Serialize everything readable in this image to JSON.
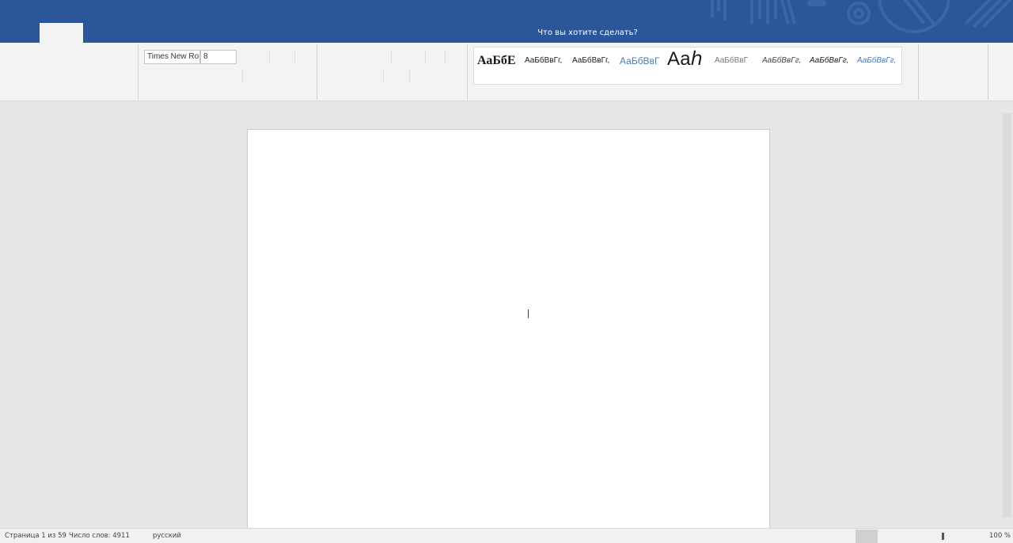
{
  "title_bar": {
    "tell_me": "Что вы хотите сделать?",
    "colors": {
      "background": "#2b579a",
      "active_tab": "#f3f3f3"
    }
  },
  "ribbon": {
    "font_name": "Times New Roman",
    "font_size": "8",
    "styles": [
      {
        "sample": "АаБбЕ",
        "color": "#1a1a1a"
      },
      {
        "sample": "АаБбВвГг,",
        "color": "#1a1a1a"
      },
      {
        "sample": "АаБбВвГг,",
        "color": "#1a1a1a"
      },
      {
        "sample": "АаБбВвГ",
        "color": "#4a79b1"
      },
      {
        "sample": "Ааℎ",
        "color": "#1a1a1a"
      },
      {
        "sample": "АаБбВвГ",
        "color": "#777777"
      },
      {
        "sample": "АаБбВвГг,",
        "color": "#444444"
      },
      {
        "sample": "АаБбВвГг,",
        "color": "#1a1a1a"
      },
      {
        "sample": "АаБбВвГг,",
        "color": "#4a79b1"
      }
    ]
  },
  "status_bar": {
    "page": "Страница 1 из 59",
    "words": "Число слов: 4911",
    "language": "русский",
    "zoom": "100 %"
  }
}
